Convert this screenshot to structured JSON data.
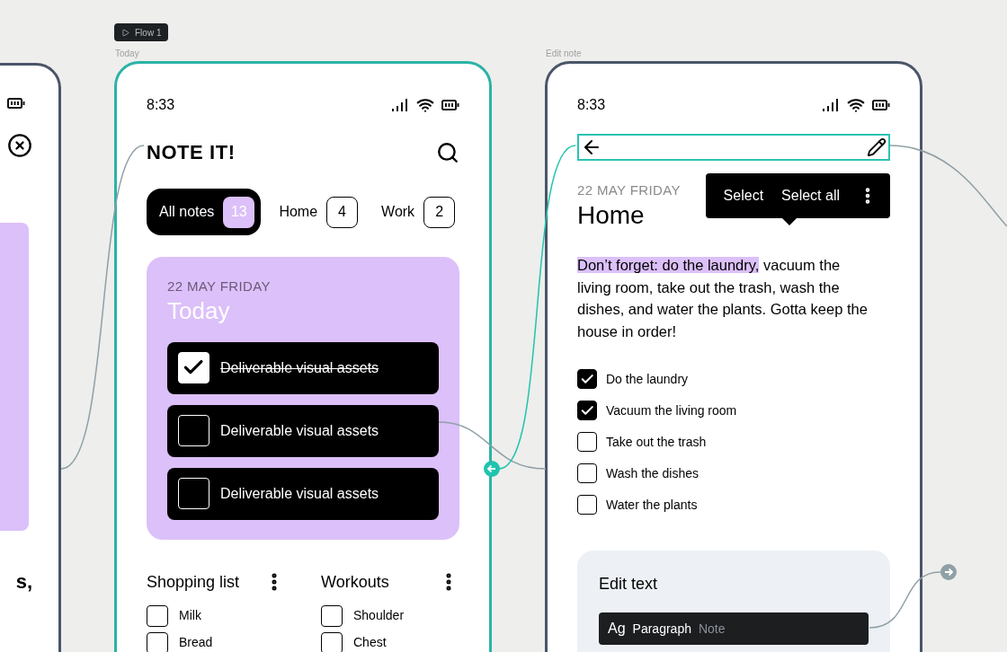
{
  "flow": {
    "label": "Flow 1"
  },
  "left_frame": {
    "text": "s,"
  },
  "today_frame": {
    "label": "Today",
    "selected": true,
    "time": "8:33",
    "app_title": "NOTE IT!",
    "filters": [
      {
        "label": "All notes",
        "count": "13",
        "selected": true
      },
      {
        "label": "Home",
        "count": "4",
        "selected": false
      },
      {
        "label": "Work",
        "count": "2",
        "selected": false
      }
    ],
    "card": {
      "date": "22 MAY FRIDAY",
      "title": "Today",
      "tasks": [
        {
          "text": "Deliverable visual assets",
          "checked": true
        },
        {
          "text": "Deliverable visual assets",
          "checked": false
        },
        {
          "text": "Deliverable visual assets",
          "checked": false
        }
      ]
    },
    "lists": [
      {
        "title": "Shopping list",
        "items": [
          {
            "text": "Milk",
            "checked": false
          },
          {
            "text": "Bread",
            "checked": false
          }
        ]
      },
      {
        "title": "Workouts",
        "items": [
          {
            "text": "Shoulder",
            "checked": false
          },
          {
            "text": "Chest",
            "checked": false
          }
        ]
      }
    ]
  },
  "edit_frame": {
    "label": "Edit note",
    "selected": false,
    "time": "8:33",
    "date": "22 MAY FRIDAY",
    "title": "Home",
    "menu": [
      "Select",
      "Select all"
    ],
    "highlight": "Don’t forget: do the laundry,",
    "body": " vacuum the living room, take out the trash, wash the dishes, and water the plants. Gotta keep the house in order!",
    "checklist": [
      {
        "text": "Do the laundry",
        "checked": true
      },
      {
        "text": "Vacuum the living room",
        "checked": true
      },
      {
        "text": "Take out the trash",
        "checked": false
      },
      {
        "text": "Wash the dishes",
        "checked": false
      },
      {
        "text": "Water the plants",
        "checked": false
      }
    ],
    "panel": {
      "title": "Edit text",
      "sample": "Ag",
      "style": "Paragraph",
      "group": "Note"
    }
  }
}
